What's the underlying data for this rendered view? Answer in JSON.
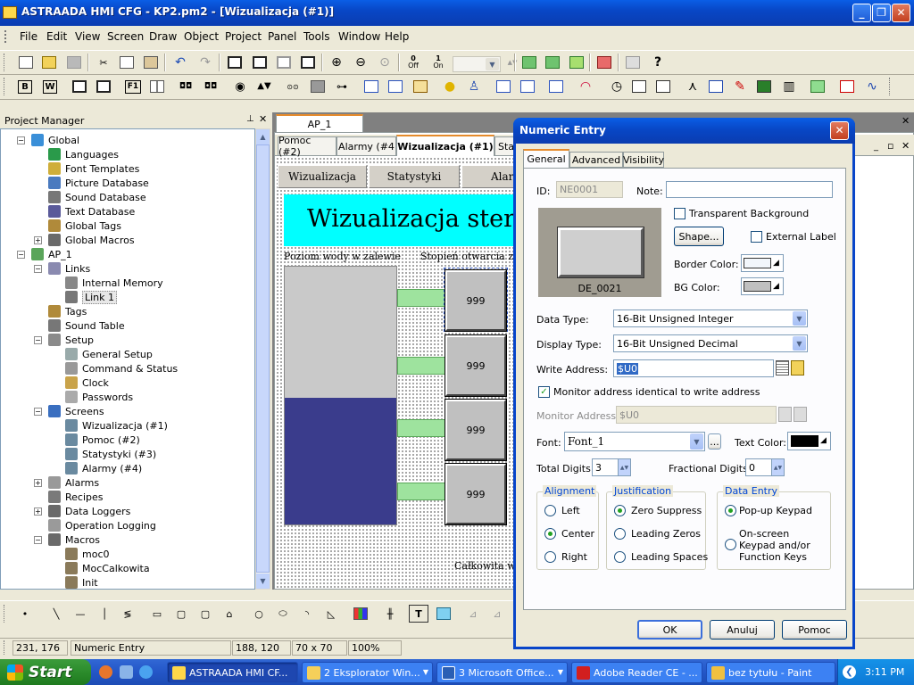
{
  "app": {
    "title": "ASTRAADA HMI CFG - KP2.pm2 - [Wizualizacja (#1)]"
  },
  "menu": [
    "File",
    "Edit",
    "View",
    "Screen",
    "Draw",
    "Object",
    "Project",
    "Panel",
    "Tools",
    "Window",
    "Help"
  ],
  "toolbar": {
    "off_label": "Off",
    "on_label": "On",
    "b_label": "B",
    "w_label": "W",
    "f_label": "F1"
  },
  "project_manager": {
    "title": "Project Manager",
    "tree": [
      {
        "label": "Global",
        "icon": "global-icon"
      },
      {
        "label": "Languages",
        "icon": "globe-icon"
      },
      {
        "label": "Font Templates",
        "icon": "font-icon"
      },
      {
        "label": "Picture Database",
        "icon": "picture-icon"
      },
      {
        "label": "Sound Database",
        "icon": "speaker-icon"
      },
      {
        "label": "Text Database",
        "icon": "text-icon"
      },
      {
        "label": "Global Tags",
        "icon": "tag-icon"
      },
      {
        "label": "Global Macros",
        "icon": "macro-icon"
      },
      {
        "label": "AP_1",
        "icon": "panel-icon"
      },
      {
        "label": "Links",
        "icon": "links-icon"
      },
      {
        "label": "Internal Memory",
        "icon": "memory-icon"
      },
      {
        "label": "Link 1",
        "icon": "link-icon"
      },
      {
        "label": "Tags",
        "icon": "tag-icon"
      },
      {
        "label": "Sound Table",
        "icon": "speaker-icon"
      },
      {
        "label": "Setup",
        "icon": "wrench-icon"
      },
      {
        "label": "General Setup",
        "icon": "setup-icon"
      },
      {
        "label": "Command & Status",
        "icon": "command-icon"
      },
      {
        "label": "Clock",
        "icon": "clock-icon"
      },
      {
        "label": "Passwords",
        "icon": "key-icon"
      },
      {
        "label": "Screens",
        "icon": "screens-icon"
      },
      {
        "label": "Wizualizacja (#1)",
        "icon": "screen-icon"
      },
      {
        "label": "Pomoc (#2)",
        "icon": "screen-icon"
      },
      {
        "label": "Statystyki (#3)",
        "icon": "screen-icon"
      },
      {
        "label": "Alarmy (#4)",
        "icon": "screen-icon"
      },
      {
        "label": "Alarms",
        "icon": "alarm-icon"
      },
      {
        "label": "Recipes",
        "icon": "recipe-icon"
      },
      {
        "label": "Data Loggers",
        "icon": "logger-icon"
      },
      {
        "label": "Operation Logging",
        "icon": "log-icon"
      },
      {
        "label": "Macros",
        "icon": "macro-icon"
      },
      {
        "label": "moc0",
        "icon": "macro-file-icon"
      },
      {
        "label": "MocCalkowita",
        "icon": "macro-file-icon"
      },
      {
        "label": "Init",
        "icon": "macro-file-icon"
      }
    ]
  },
  "doc": {
    "ap_tab": "AP_1",
    "screen_tabs": [
      "Pomoc (#2)",
      "Alarmy (#4",
      "Wizualizacja (#1)",
      "Sta"
    ],
    "nav": [
      "Wizualizacja",
      "Statystyki",
      "Alar"
    ],
    "banner": "Wizualizacja stero",
    "label_left": "Poziom wody w zalewie",
    "label_right": "Stopień otwarcia zaw",
    "boxes": [
      "999",
      "999",
      "999",
      "999"
    ],
    "bottom_text": "Całkowita wy",
    "tank_level": 0.49
  },
  "dialog": {
    "title": "Numeric Entry",
    "tabs": [
      "General",
      "Advanced",
      "Visibility"
    ],
    "id_label": "ID:",
    "id_value": "NE0001",
    "note_label": "Note:",
    "note_value": "",
    "preview_caption": "DE_0021",
    "transparent_label": "Transparent Background",
    "shape_button": "Shape...",
    "external_label": "External Label",
    "border_color_label": "Border Color:",
    "bg_color_label": "BG Color:",
    "data_type_label": "Data Type:",
    "data_type_value": "16-Bit Unsigned Integer",
    "display_type_label": "Display Type:",
    "display_type_value": "16-Bit Unsigned Decimal",
    "write_address_label": "Write Address:",
    "write_address_value": "$U0",
    "monitor_identical_label": "Monitor address identical to write address",
    "monitor_address_label": "Monitor Address:",
    "monitor_address_value": "$U0",
    "font_label": "Font:",
    "font_value": "Font_1",
    "ellipsis": "...",
    "text_color_label": "Text Color:",
    "total_digits_label": "Total Digits:",
    "total_digits_value": "3",
    "fractional_digits_label": "Fractional Digits:",
    "fractional_digits_value": "0",
    "alignment": {
      "title": "Alignment",
      "options": [
        "Left",
        "Center",
        "Right"
      ],
      "selected": "Center"
    },
    "justification": {
      "title": "Justification",
      "options": [
        "Zero Suppress",
        "Leading Zeros",
        "Leading Spaces"
      ],
      "selected": "Zero Suppress"
    },
    "data_entry": {
      "title": "Data Entry",
      "options": [
        "Pop-up Keypad",
        "On-screen Keypad and/or Function Keys"
      ],
      "selected": "Pop-up Keypad"
    },
    "ok": "OK",
    "cancel": "Anuluj",
    "help": "Pomoc"
  },
  "status": {
    "coords": "231, 176",
    "mode": "Numeric Entry",
    "position": "188, 120",
    "size": "70 x 70",
    "zoom": "100%"
  },
  "taskbar": {
    "start": "Start",
    "tasks": [
      "ASTRAADA HMI CF...",
      "2 Eksplorator Win...",
      "3 Microsoft Office...",
      "Adobe Reader CE - ...",
      "bez tytułu - Paint"
    ],
    "time": "3:11 PM"
  },
  "colors": {
    "titlebar": "#0a4fd6",
    "cyan_banner": "#00ffff",
    "tank_water": "#3a3c8c",
    "tank_empty": "#c9c9c9",
    "green_bar": "#9ee39e"
  }
}
